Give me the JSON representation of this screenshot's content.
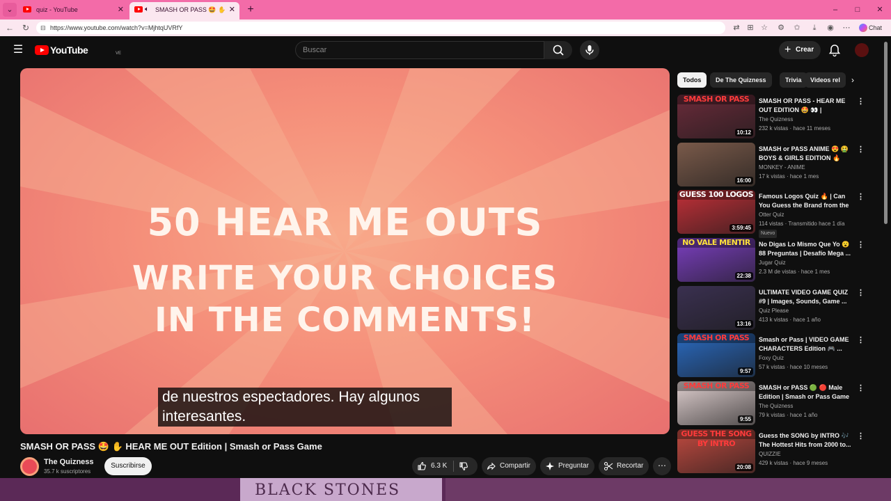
{
  "browser": {
    "tabs": [
      {
        "title": "quiz - YouTube",
        "active": false
      },
      {
        "title": "SMASH OR PASS 🤩 ✋ HEAR",
        "active": true
      }
    ],
    "url": "https://www.youtube.com/watch?v=MjhtqUVRfY",
    "copilot_label": "Chat",
    "window_controls": [
      "–",
      "□",
      "✕"
    ]
  },
  "masthead": {
    "logo_text": "YouTube",
    "country_code": "VE",
    "search_placeholder": "Buscar",
    "create_label": "Crear"
  },
  "player": {
    "video_lines": [
      "50 HEAR ME OUTS",
      "WRITE YOUR CHOICES",
      "IN THE COMMENTS!"
    ],
    "caption_line_1": "de nuestros espectadores. Hay algunos",
    "caption_line_2": "interesantes."
  },
  "video": {
    "title": "SMASH OR PASS 🤩 ✋ HEAR ME OUT Edition | Smash or Pass Game",
    "channel": "The Quizness",
    "subscribers": "35.7 k suscriptores",
    "subscribe_label": "Suscribirse",
    "likes": "6.3 K",
    "share_label": "Compartir",
    "ask_label": "Preguntar",
    "clip_label": "Recortar"
  },
  "chips": [
    "Todos",
    "De The Quizness",
    "Trivia",
    "Videos rel"
  ],
  "recommendations": [
    {
      "title": "SMASH OR PASS - HEAR ME OUT EDITION 🤩 👀 | Celebrity...",
      "channel": "The Quizness",
      "meta": "232 k vistas · hace 11 meses",
      "duration": "10:12",
      "banner": "SMASH OR PASS",
      "banner_color": "#ff3b3b",
      "bg": "#6a2b3a",
      "badge": ""
    },
    {
      "title": "SMASH or PASS ANIME 😍 🤮 BOYS & GIRLS EDITION 🔥 [TH...",
      "channel": "MONKEY - ANIME",
      "meta": "17 k vistas · hace 1 mes",
      "duration": "16:00",
      "banner": "",
      "banner_color": "#ff3b3b",
      "bg": "#7a5a4a",
      "badge": ""
    },
    {
      "title": "Famous Logos Quiz 🔥 | Can You Guess the Brand from the ...",
      "channel": "Otter Quiz",
      "meta": "114 vistas · Transmitido hace 1 día",
      "duration": "3:59:45",
      "banner": "GUESS 100 LOGOS",
      "banner_color": "#ffffff",
      "bg": "#c23038",
      "badge": "Nuevo"
    },
    {
      "title": "No Digas Lo Mismo Que Yo 😮 88 Preguntas | Desafío Mega ...",
      "channel": "Jugar Quiz",
      "meta": "2.3 M de vistas · hace 1 mes",
      "duration": "22:38",
      "banner": "NO VALE MENTIR",
      "banner_color": "#ffe23b",
      "bg": "#7b3fc0",
      "badge": ""
    },
    {
      "title": "ULTIMATE VIDEO GAME QUIZ #9 | Images, Sounds, Game ...",
      "channel": "Quiz Please",
      "meta": "413 k vistas · hace 1 año",
      "duration": "13:16",
      "banner": "",
      "banner_color": "#ffffff",
      "bg": "#3a3050",
      "badge": ""
    },
    {
      "title": "Smash or Pass | VIDEO GAME CHARACTERS Edition 🎮 ...",
      "channel": "Foxy Quiz",
      "meta": "57 k vistas · hace 10 meses",
      "duration": "9:57",
      "banner": "SMASH OR PASS",
      "banner_color": "#ff3b3b",
      "bg": "#2a6ac0",
      "badge": ""
    },
    {
      "title": "SMASH or PASS 🟢 🔴 Male Edition | Smash or Pass Game",
      "channel": "The Quizness",
      "meta": "79 k vistas · hace 1 año",
      "duration": "9:55",
      "banner": "SMASH OR PASS",
      "banner_color": "#ff3b3b",
      "bg": "#e0d0d0",
      "badge": ""
    },
    {
      "title": "Guess the SONG by INTRO 🎶 The  Hottest Hits from 2000 to...",
      "channel": "QUIZZIE",
      "meta": "429 k vistas · hace 9 meses",
      "duration": "20:08",
      "banner": "GUESS THE SONG BY INTRO",
      "banner_color": "#ff3b3b",
      "bg": "#c04a40",
      "badge": ""
    }
  ],
  "desktop": {
    "wall_text": "BLACK STONES"
  },
  "colors": {
    "accent": "#ff0000",
    "tab_bar": "#f36ba8",
    "page_bg": "#0f0f0f"
  }
}
